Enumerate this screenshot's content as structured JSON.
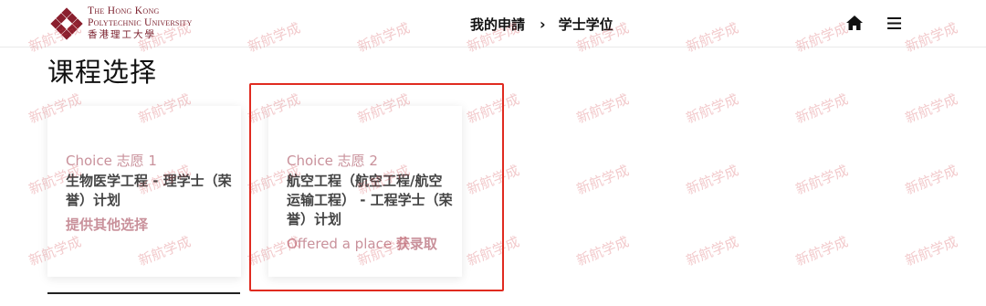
{
  "header": {
    "logo": {
      "en_line1": "The Hong Kong",
      "en_line2": "Polytechnic University",
      "zh": "香港理工大學"
    },
    "breadcrumb": [
      "我的申請",
      "学士学位"
    ],
    "breadcrumb_separator": "›",
    "icons": {
      "home": "home-icon",
      "menu": "hamburger-menu-icon"
    }
  },
  "page_title": "课程选择",
  "choices": [
    {
      "choice_label": "Choice 志愿 1",
      "programme": "生物医学工程 - 理学士（荣誉）计划",
      "action": "提供其他选择"
    },
    {
      "choice_label": "Choice 志愿 2",
      "programme": "航空工程（航空工程/航空运输工程） - 工程学士（荣誉）计划",
      "status_en": "Offered a place",
      "status_zh": "获录取"
    }
  ],
  "watermark_text": "新航学成",
  "colors": {
    "brand": "#7a1e2b",
    "accent_pink": "#c9919b",
    "highlight": "#e02b20",
    "watermark": "#d23c46"
  }
}
